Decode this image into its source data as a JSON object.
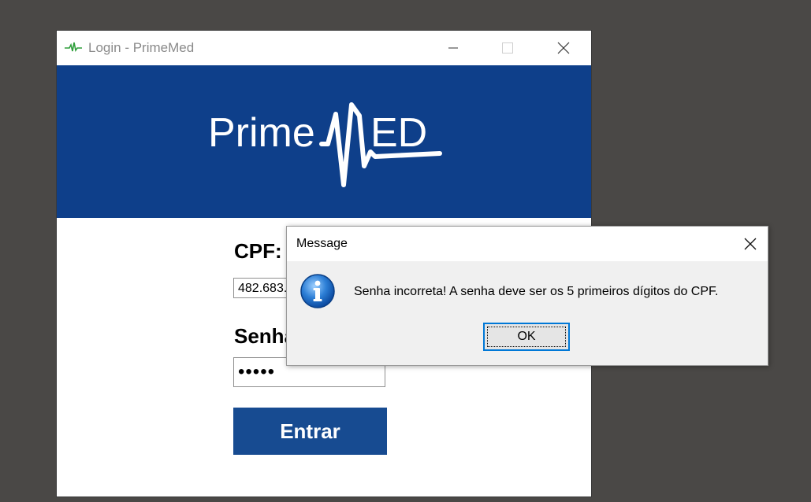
{
  "login_window": {
    "title": "Login - PrimeMed",
    "app_icon": "pulse-icon",
    "controls": {
      "minimize": "minimize-icon",
      "maximize": "maximize-icon",
      "close": "close-icon"
    },
    "logo": {
      "text_left": "Prime",
      "text_right": "ED",
      "wordmark": "PrimeMED"
    },
    "cpf_label": "CPF:",
    "cpf_value": "482.683.",
    "senha_label": "Senha:",
    "senha_value": "•••••",
    "submit_label": "Entrar"
  },
  "message_dialog": {
    "title": "Message",
    "icon": "info-icon",
    "text": "Senha incorreta! A senha deve ser os 5 primeiros dígitos do CPF.",
    "ok_label": "OK"
  },
  "colors": {
    "desktop": "#4a4846",
    "banner": "#0e3f8a",
    "button": "#174b91",
    "dialog_bg": "#f0f0f0",
    "focus_border": "#0078d7"
  }
}
